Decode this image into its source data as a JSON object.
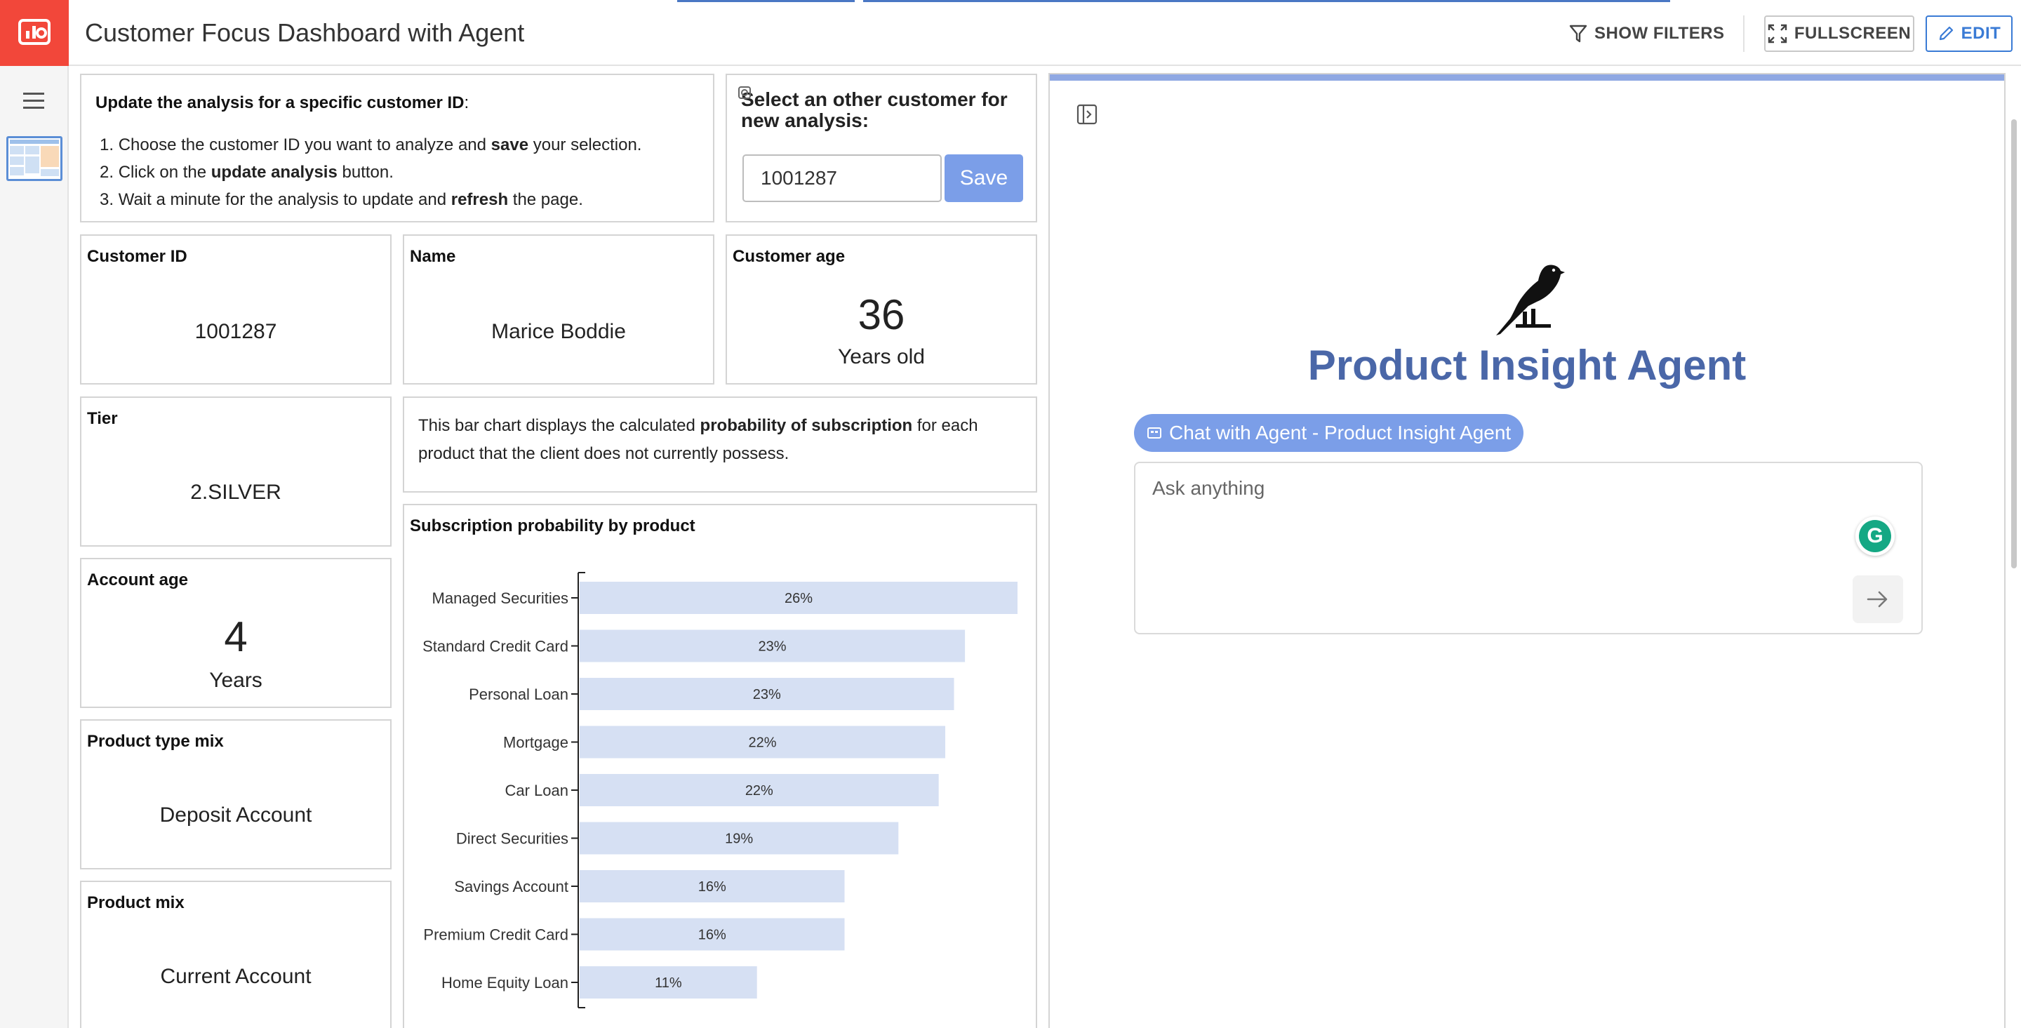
{
  "app": {
    "title": "Customer Focus Dashboard with Agent",
    "show_filters": "SHOW FILTERS",
    "fullscreen": "FULLSCREEN",
    "edit": "EDIT"
  },
  "instructions": {
    "heading_prefix": "Update the analysis for a specific customer ID",
    "heading_suffix": ":",
    "steps": [
      {
        "num": "1.",
        "pre": "Choose the customer ID you want to analyze and ",
        "bold": "save",
        "post": " your selection."
      },
      {
        "num": "2.",
        "pre": "Click on the ",
        "bold": "update analysis",
        "post": " button."
      },
      {
        "num": "3.",
        "pre": "Wait a minute for the analysis to update and ",
        "bold": "refresh",
        "post": " the page."
      }
    ]
  },
  "selector": {
    "prompt": "Select an other customer for new analysis:",
    "value": "1001287",
    "save_label": "Save"
  },
  "cards": {
    "customer_id": {
      "label": "Customer ID",
      "value": "1001287"
    },
    "name": {
      "label": "Name",
      "value": "Marice Boddie"
    },
    "customer_age": {
      "label": "Customer age",
      "value": "36",
      "unit": "Years old"
    },
    "tier": {
      "label": "Tier",
      "value": "2.SILVER"
    },
    "account_age": {
      "label": "Account age",
      "value": "4",
      "unit": "Years"
    },
    "product_type_mix": {
      "label": "Product type mix",
      "value": "Deposit Account"
    },
    "product_mix": {
      "label": "Product mix",
      "value": "Current Account"
    }
  },
  "description": {
    "pre": "This bar chart displays the calculated ",
    "bold": "probability of subscription",
    "post": " for each product that the client does not currently possess."
  },
  "chart_data": {
    "type": "bar",
    "orientation": "horizontal",
    "title": "Subscription probability by product",
    "categories": [
      "Managed Securities",
      "Standard Credit Card",
      "Personal Loan",
      "Mortgage",
      "Car Loan",
      "Direct Securities",
      "Savings Account",
      "Premium Credit Card",
      "Home Equity Loan"
    ],
    "values": [
      26,
      23,
      23,
      22,
      22,
      19,
      16,
      16,
      11
    ],
    "value_labels": [
      "26%",
      "23%",
      "23%",
      "22%",
      "22%",
      "19%",
      "16%",
      "16%",
      "11%"
    ],
    "bar_fractions": [
      1.0,
      0.88,
      0.855,
      0.835,
      0.82,
      0.728,
      0.605,
      0.605,
      0.405
    ],
    "bar_color": "#d6e0f3",
    "grid": false
  },
  "agent": {
    "title": "Product Insight Agent",
    "chip_label": "Chat with Agent - Product Insight Agent",
    "input_placeholder": "Ask anything",
    "grammarly_letter": "G",
    "title_color": "#4a67a8",
    "chip_color": "#7b9ee8"
  },
  "colors": {
    "brand": "#f2473a",
    "accent": "#3a7bd5"
  }
}
